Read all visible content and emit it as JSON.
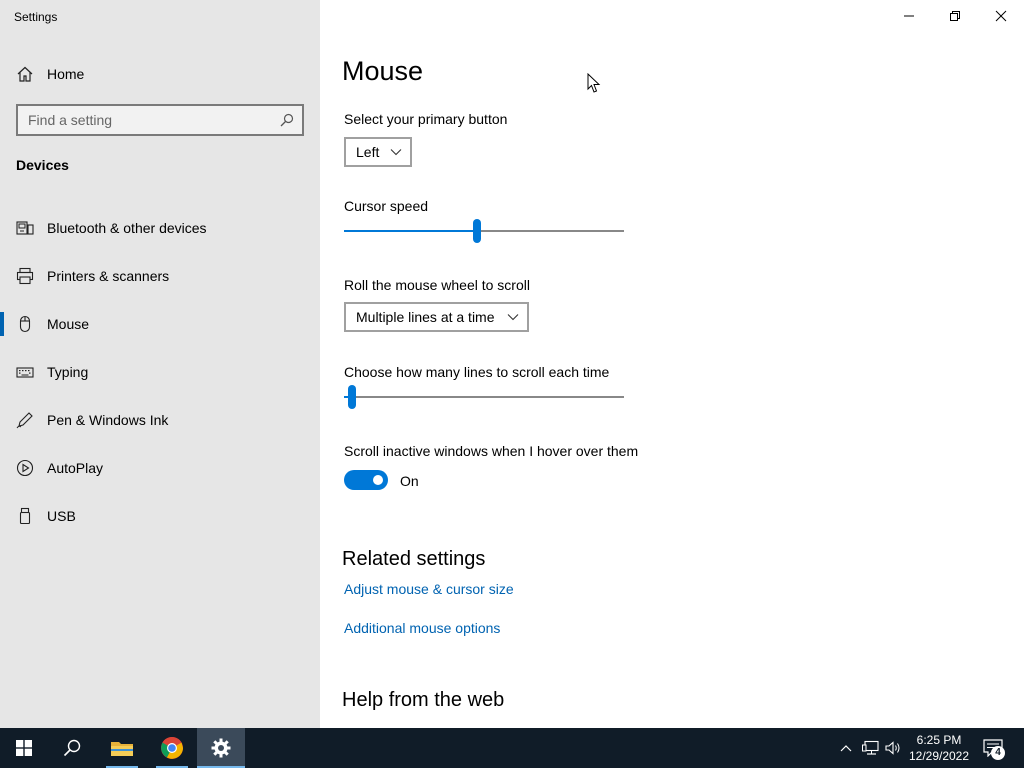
{
  "window": {
    "title": "Settings"
  },
  "sidebar": {
    "home_label": "Home",
    "search_placeholder": "Find a setting",
    "section_title": "Devices",
    "items": [
      {
        "label": "Bluetooth & other devices",
        "icon": "bluetooth-devices-icon"
      },
      {
        "label": "Printers & scanners",
        "icon": "printer-icon"
      },
      {
        "label": "Mouse",
        "icon": "mouse-icon",
        "active": true
      },
      {
        "label": "Typing",
        "icon": "keyboard-icon"
      },
      {
        "label": "Pen & Windows Ink",
        "icon": "pen-icon"
      },
      {
        "label": "AutoPlay",
        "icon": "autoplay-icon"
      },
      {
        "label": "USB",
        "icon": "usb-icon"
      }
    ]
  },
  "main": {
    "page_title": "Mouse",
    "primary_button": {
      "label": "Select your primary button",
      "value": "Left"
    },
    "cursor_speed": {
      "label": "Cursor speed",
      "level_fraction": 0.475
    },
    "wheel_scroll": {
      "label": "Roll the mouse wheel to scroll",
      "value": "Multiple lines at a time"
    },
    "lines_to_scroll": {
      "label": "Choose how many lines to scroll each time",
      "level_fraction": 0.03
    },
    "inactive_scroll": {
      "label": "Scroll inactive windows when I hover over them",
      "state": "On",
      "on": true
    },
    "related": {
      "heading": "Related settings",
      "links": [
        "Adjust mouse & cursor size",
        "Additional mouse options"
      ]
    },
    "help_heading": "Help from the web"
  },
  "taskbar": {
    "time": "6:25 PM",
    "date": "12/29/2022",
    "notification_count": "4"
  },
  "colors": {
    "accent": "#0078d7",
    "link": "#0063b1",
    "sidebar_bg": "#e6e6e6",
    "taskbar_bg": "#101c28"
  }
}
